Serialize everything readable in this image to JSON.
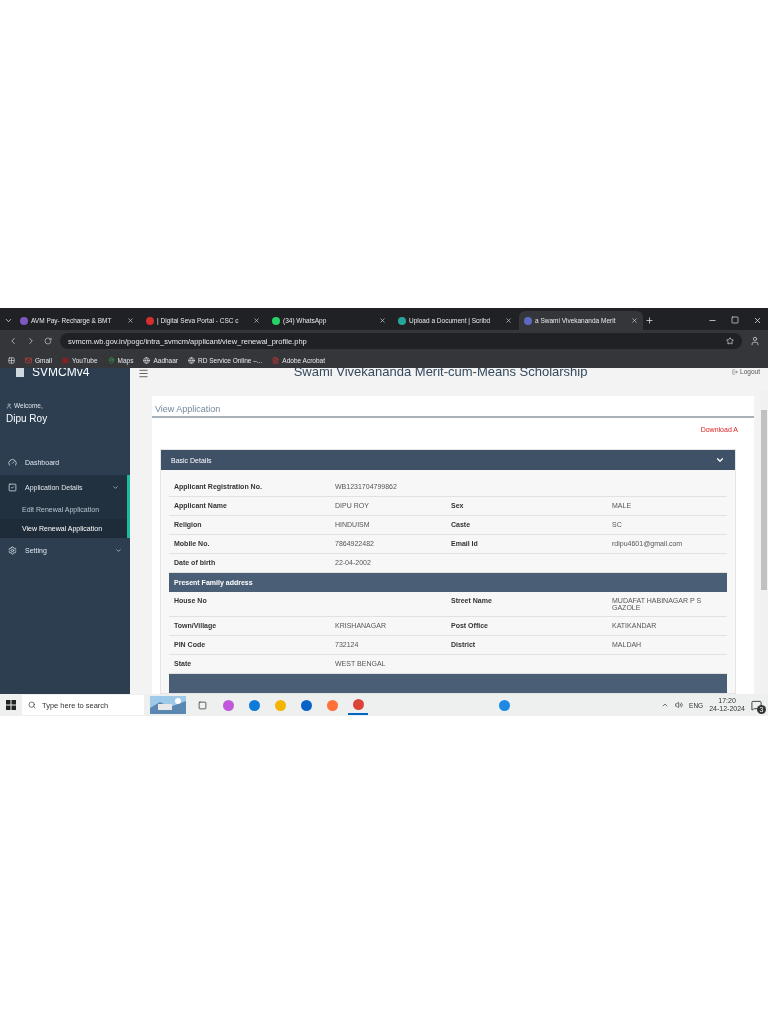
{
  "browser": {
    "tabs": [
      {
        "label": "AVM Pay- Recharge & BMT",
        "selected": false
      },
      {
        "label": "| Digital Seva Portal - CSC c",
        "selected": false
      },
      {
        "label": "(34) WhatsApp",
        "selected": false
      },
      {
        "label": "Upload a Document | Scribd",
        "selected": false
      },
      {
        "label": "a Swami Vivekananda Merit",
        "selected": true
      }
    ],
    "url": "svmcm.wb.gov.in/pogc/intra_svmcm/applicant/view_renewal_profile.php",
    "bookmarks": [
      "Gmail",
      "YouTube",
      "Maps",
      "Aadhaar",
      "RD Service Online –...",
      "Adobe Acrobat"
    ]
  },
  "sidebar": {
    "brand": "SVMCMv4",
    "welcome": "Welcome,",
    "user": "Dipu Roy",
    "items": [
      {
        "label": "Dashboard",
        "expanded": false
      },
      {
        "label": "Application Details",
        "expanded": true,
        "children": [
          {
            "label": "Edit Renewal Application",
            "selected": false
          },
          {
            "label": "View Renewal Application",
            "selected": true
          }
        ]
      },
      {
        "label": "Setting",
        "expanded": false
      }
    ]
  },
  "header": {
    "title": "Swami Vivekananda Merit-cum-Means Scholarship",
    "logout": "Logout"
  },
  "card": {
    "title": "View Application",
    "download": "Download A",
    "panel": {
      "title": "Basic Details",
      "expanded": true,
      "blocks": [
        {
          "kind": "row",
          "cells": [
            {
              "label": "Applicant Registration No.",
              "value": "WB1231704799862"
            }
          ]
        },
        {
          "kind": "row",
          "cells": [
            {
              "label": "Applicant Name",
              "value": "DIPU ROY"
            },
            {
              "label": "Sex",
              "value": "MALE"
            }
          ]
        },
        {
          "kind": "row",
          "cells": [
            {
              "label": "Religion",
              "value": "HINDUISM"
            },
            {
              "label": "Caste",
              "value": "SC"
            }
          ]
        },
        {
          "kind": "row",
          "cells": [
            {
              "label": "Mobile No.",
              "value": "7864922482"
            },
            {
              "label": "Email Id",
              "value": "rdipu4601@gmail.com"
            }
          ]
        },
        {
          "kind": "row",
          "cells": [
            {
              "label": "Date of birth",
              "value": "22-04-2002"
            }
          ]
        },
        {
          "kind": "heading",
          "text": "Present Family address"
        },
        {
          "kind": "row",
          "cells": [
            {
              "label": "House No"
            },
            {
              "label": "Street Name",
              "value": "MUDAFAT HABINAGAR P S GAZOLE"
            }
          ]
        },
        {
          "kind": "row",
          "cells": [
            {
              "label": "Town/Village",
              "value": "KRISHANAGAR"
            },
            {
              "label": "Post Office",
              "value": "KATIKANDAR"
            }
          ]
        },
        {
          "kind": "row",
          "cells": [
            {
              "label": "PIN Code",
              "value": "732124"
            },
            {
              "label": "District",
              "value": "MALDAH"
            }
          ]
        },
        {
          "kind": "row",
          "cells": [
            {
              "label": "State",
              "value": "WEST BENGAL"
            }
          ]
        },
        {
          "kind": "heading"
        }
      ]
    }
  },
  "taskbar": {
    "search": "Type here to search",
    "language": "ENG",
    "time": "17:20",
    "date": "24-12-2024",
    "notifications": "3"
  }
}
